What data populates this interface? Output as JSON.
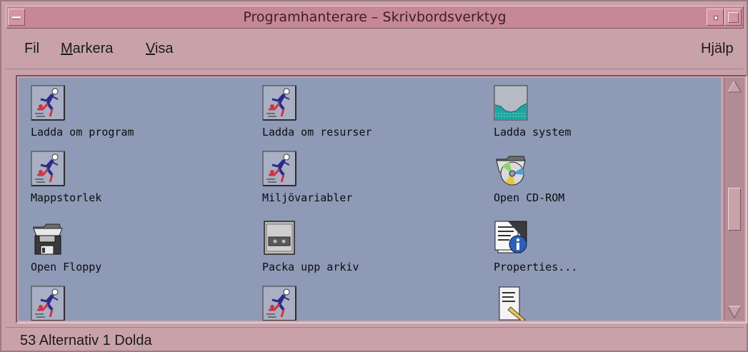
{
  "window": {
    "title": "Programhanterare – Skrivbordsverktyg"
  },
  "menubar": {
    "fil": "Fil",
    "markera_underlined": "M",
    "markera_rest": "arkera",
    "visa_underlined": "V",
    "visa_rest": "isa",
    "help": "Hjälp"
  },
  "items": [
    {
      "label": "Ladda om program",
      "icon": "running-man-icon"
    },
    {
      "label": "Ladda om resurser",
      "icon": "running-man-icon"
    },
    {
      "label": "Ladda system",
      "icon": "load-graph-icon"
    },
    {
      "label": "Mappstorlek",
      "icon": "running-man-icon"
    },
    {
      "label": "Miljövariabler",
      "icon": "running-man-icon"
    },
    {
      "label": "Open CD-ROM",
      "icon": "cdrom-folder-icon"
    },
    {
      "label": "Open Floppy",
      "icon": "floppy-folder-icon"
    },
    {
      "label": "Packa upp arkiv",
      "icon": "tape-archive-icon"
    },
    {
      "label": "Properties...",
      "icon": "properties-info-icon"
    },
    {
      "label": "",
      "icon": "running-man-icon"
    },
    {
      "label": "",
      "icon": "running-man-icon"
    },
    {
      "label": "",
      "icon": "document-pen-icon"
    }
  ],
  "status": {
    "text": "53 Alternativ 1 Dolda"
  }
}
